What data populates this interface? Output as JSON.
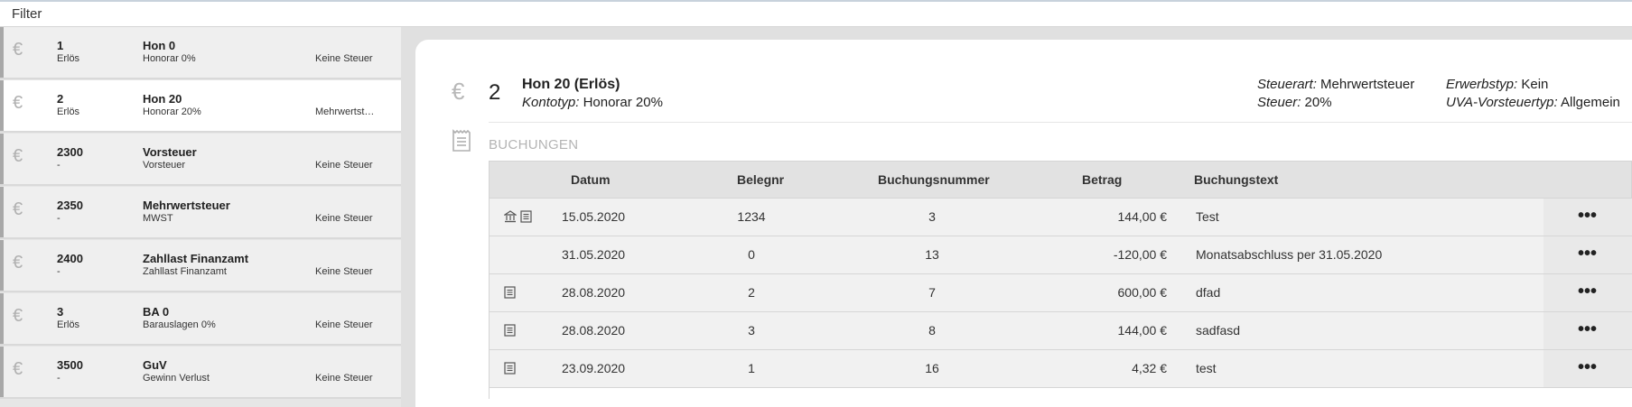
{
  "topbar": {
    "filter_label": "Filter"
  },
  "accounts": [
    {
      "number": "1",
      "type": "Erlös",
      "name": "Hon 0",
      "desc": "Honorar 0%",
      "tax": "Keine Steuer",
      "selected": false
    },
    {
      "number": "2",
      "type": "Erlös",
      "name": "Hon 20",
      "desc": "Honorar 20%",
      "tax": "Mehrwertsteuer",
      "selected": true
    },
    {
      "number": "2300",
      "type": "-",
      "name": "Vorsteuer",
      "desc": "Vorsteuer",
      "tax": "Keine Steuer",
      "selected": false
    },
    {
      "number": "2350",
      "type": "-",
      "name": "Mehrwertsteuer",
      "desc": "MWST",
      "tax": "Keine Steuer",
      "selected": false
    },
    {
      "number": "2400",
      "type": "-",
      "name": "Zahllast Finanzamt",
      "desc": "Zahllast Finanzamt",
      "tax": "Keine Steuer",
      "selected": false
    },
    {
      "number": "3",
      "type": "Erlös",
      "name": "BA 0",
      "desc": "Barauslagen 0%",
      "tax": "Keine Steuer",
      "selected": false
    },
    {
      "number": "3500",
      "type": "-",
      "name": "GuV",
      "desc": "Gewinn Verlust",
      "tax": "Keine Steuer",
      "selected": false
    }
  ],
  "detail": {
    "number": "2",
    "title": "Hon 20 (Erlös)",
    "kontotyp_label": "Kontotyp:",
    "kontotyp_value": "Honorar 20%",
    "steuerart_label": "Steuerart:",
    "steuerart_value": "Mehrwertsteuer",
    "steuer_label": "Steuer:",
    "steuer_value": "20%",
    "erwerbstyp_label": "Erwerbstyp:",
    "erwerbstyp_value": "Kein",
    "uva_label": "UVA-Vorsteuertyp:",
    "uva_value": "Allgemein",
    "section_title": "BUCHUNGEN"
  },
  "table": {
    "headers": {
      "datum": "Datum",
      "belegnr": "Belegnr",
      "buchungsnummer": "Buchungsnummer",
      "betrag": "Betrag",
      "buchungstext": "Buchungstext"
    },
    "rows": [
      {
        "datum": "15.05.2020",
        "belegnr": "1234",
        "buchungsnummer": "3",
        "betrag": "144,00 €",
        "buchungstext": "Test",
        "icons": [
          "bank-icon",
          "receipt-icon"
        ]
      },
      {
        "datum": "31.05.2020",
        "belegnr": "0",
        "buchungsnummer": "13",
        "betrag": "-120,00 €",
        "buchungstext": "Monatsabschluss per 31.05.2020",
        "icons": []
      },
      {
        "datum": "28.08.2020",
        "belegnr": "2",
        "buchungsnummer": "7",
        "betrag": "600,00 €",
        "buchungstext": "dfad",
        "icons": [
          "receipt-icon"
        ]
      },
      {
        "datum": "28.08.2020",
        "belegnr": "3",
        "buchungsnummer": "8",
        "betrag": "144,00 €",
        "buchungstext": "sadfasd",
        "icons": [
          "receipt-icon"
        ]
      },
      {
        "datum": "23.09.2020",
        "belegnr": "1",
        "buchungsnummer": "16",
        "betrag": "4,32 €",
        "buchungstext": "test",
        "icons": [
          "receipt-icon"
        ]
      }
    ],
    "menu_glyph": "•••"
  },
  "icons": {
    "euro": "€"
  }
}
